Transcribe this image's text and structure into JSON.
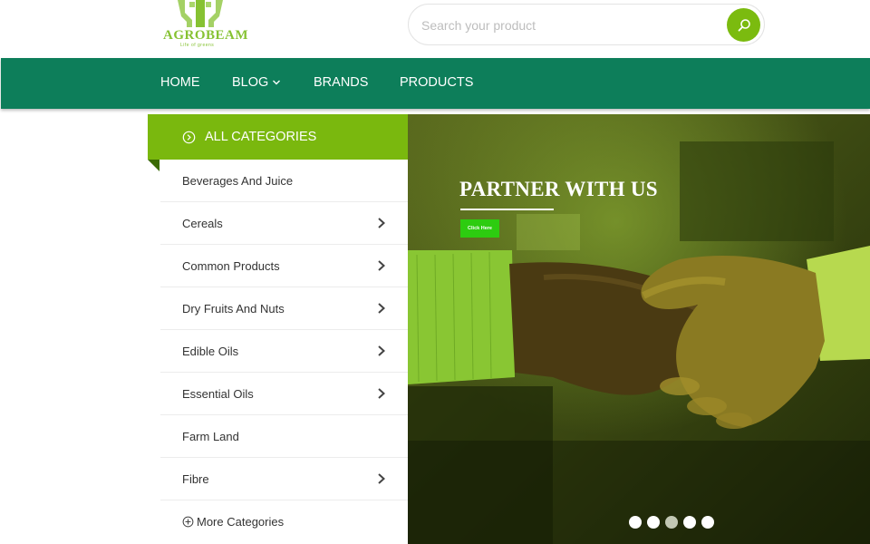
{
  "header": {
    "logo_text": "AGROBEAM",
    "logo_tagline": "Life of greens",
    "search_placeholder": "Search your product",
    "search_icon": "search-icon"
  },
  "nav": {
    "items": [
      {
        "label": "HOME"
      },
      {
        "label": "BLOG",
        "icon": "chevron-down-icon"
      },
      {
        "label": "BRANDS"
      },
      {
        "label": "PRODUCTS"
      }
    ]
  },
  "categories": {
    "header_label": "ALL CATEGORIES",
    "header_icon": "circle-arrow-right-icon",
    "items": [
      {
        "label": "Beverages And Juice",
        "has_submenu": false
      },
      {
        "label": "Cereals",
        "has_submenu": true
      },
      {
        "label": "Common Products",
        "has_submenu": true
      },
      {
        "label": "Dry Fruits And Nuts",
        "has_submenu": true
      },
      {
        "label": "Edible Oils",
        "has_submenu": true
      },
      {
        "label": "Essential Oils",
        "has_submenu": true
      },
      {
        "label": "Farm Land",
        "has_submenu": false
      },
      {
        "label": "Fibre",
        "has_submenu": true
      }
    ],
    "more_label": "More Categories",
    "more_icon": "circle-plus-icon"
  },
  "slider": {
    "title": "PARTNER WITH US",
    "button_label": "Click Here",
    "slide_count": 5,
    "active_index": 2,
    "image": "handshake-photo"
  },
  "colors": {
    "primary_green": "#0d7e5a",
    "accent_green": "#7ab80e",
    "slide_button": "#2dcc10"
  }
}
